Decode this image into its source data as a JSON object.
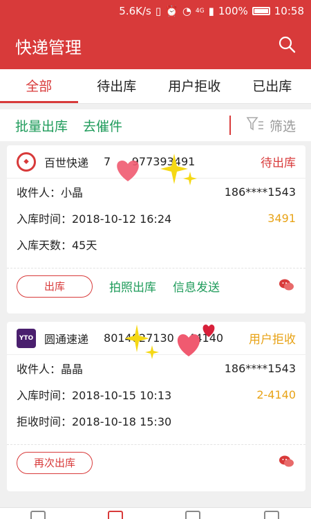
{
  "statusbar": {
    "speed": "5.6K/s",
    "network": "4G",
    "battery": "100%",
    "time": "10:58"
  },
  "appbar": {
    "title": "快递管理"
  },
  "tabs": [
    {
      "label": "全部",
      "active": true
    },
    {
      "label": "待出库",
      "active": false
    },
    {
      "label": "用户拒收",
      "active": false
    },
    {
      "label": "已出库",
      "active": false
    }
  ],
  "actions": {
    "batch_out": "批量出库",
    "urge": "去催件",
    "filter": "筛选"
  },
  "cards": [
    {
      "courier": "百世快递",
      "tracking": "7      977393491",
      "status": "待出库",
      "recipient_label": "收件人：小晶",
      "phone": "186****1543",
      "time_label": "入库时间：2018-10-12 16:24",
      "code": "3491",
      "extra_label": "入库天数：45天",
      "primary_button": "出库",
      "photo_out": "拍照出库",
      "send_info": "信息发送"
    },
    {
      "courier": "圆通速递",
      "tracking": "8014027130    44140",
      "status": "用户拒收",
      "recipient_label": "收件人：晶晶",
      "phone": "186****1543",
      "time_label": "入库时间：2018-10-15 10:13",
      "code": "2-4140",
      "extra_label": "拒收时间：2018-10-18 15:30",
      "primary_button": "再次出库"
    }
  ],
  "colors": {
    "brand": "#d83a3a",
    "green": "#1e9b5a",
    "orange": "#e8a317"
  }
}
